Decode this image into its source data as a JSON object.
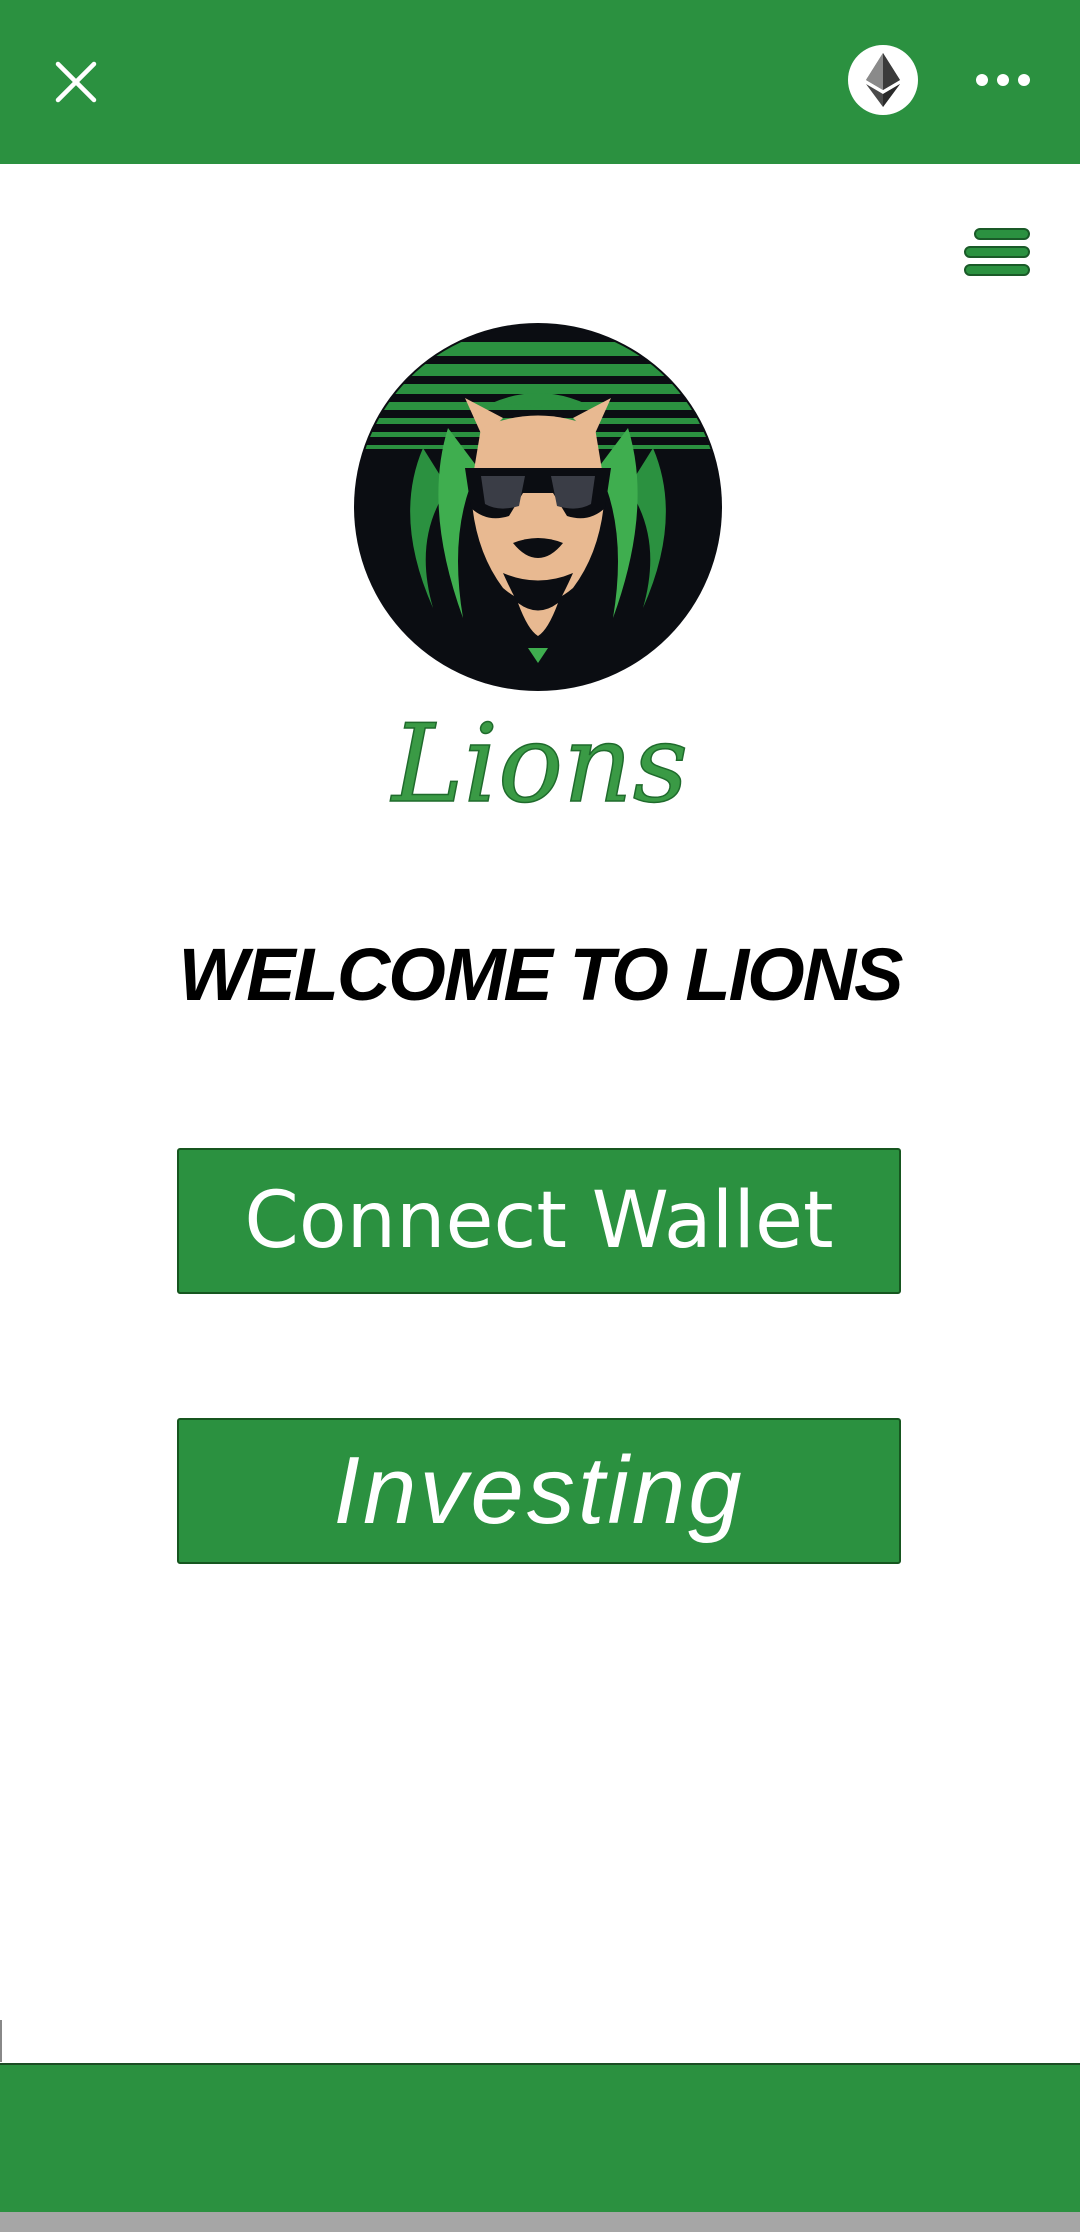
{
  "colors": {
    "brand_green": "#2b9140",
    "brand_green_dark": "#16561f",
    "text_black": "#000000",
    "white": "#ffffff",
    "logo_tan": "#e8b991",
    "logo_dark": "#0b0d12"
  },
  "topbar": {
    "close_icon": "close-icon",
    "network_icon": "ethereum-icon",
    "more_icon": "more-horizontal-icon"
  },
  "header": {
    "menu_icon": "hamburger-menu-icon"
  },
  "brand": {
    "logo_icon": "lion-logo",
    "name": "Lions"
  },
  "main": {
    "welcome": "WELCOME TO LIONS",
    "connect_label": "Connect Wallet",
    "investing_label": "Investing"
  }
}
